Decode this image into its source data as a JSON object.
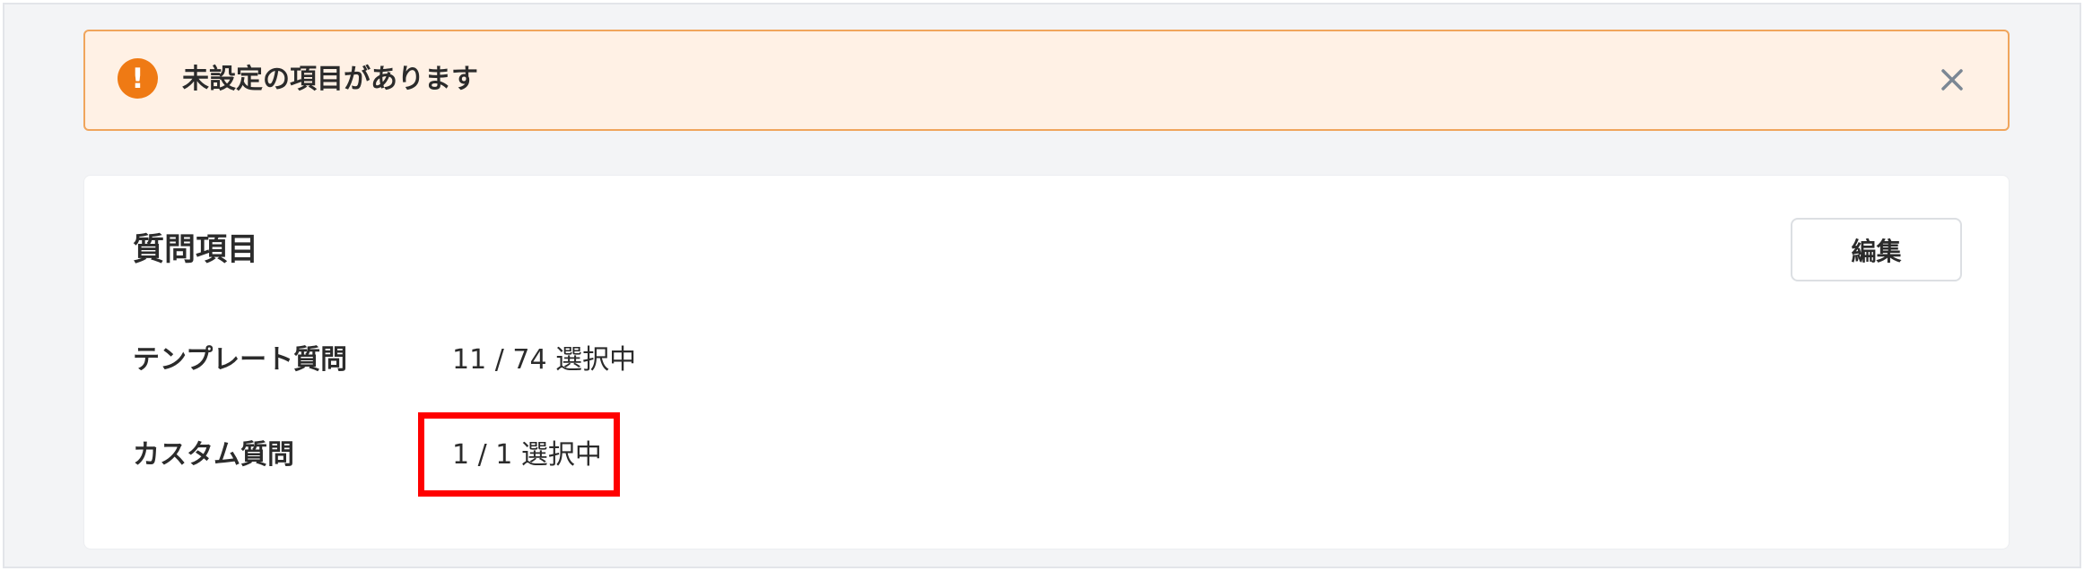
{
  "alert": {
    "icon": "exclamation-icon",
    "message": "未設定の項目があります",
    "close_icon": "close-icon",
    "colors": {
      "background": "#fff1e5",
      "border": "#f0a55c",
      "icon": "#ef7a14"
    }
  },
  "card": {
    "title": "質問項目",
    "edit_label": "編集",
    "rows": [
      {
        "label": "テンプレート質問",
        "value": "11 / 74 選択中"
      },
      {
        "label": "カスタム質問",
        "value": "1 / 1 選択中"
      }
    ]
  },
  "annotation": {
    "highlight_color": "#ff0000"
  }
}
